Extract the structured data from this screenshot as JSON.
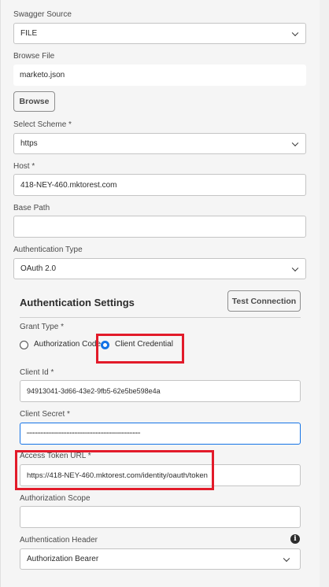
{
  "swagger_source": {
    "label": "Swagger Source",
    "value": "FILE"
  },
  "browse_file": {
    "label": "Browse File",
    "value": "marketo.json",
    "button": "Browse"
  },
  "select_scheme": {
    "label": "Select Scheme *",
    "value": "https"
  },
  "host": {
    "label": "Host *",
    "value": "418-NEY-460.mktorest.com"
  },
  "base_path": {
    "label": "Base Path",
    "value": ""
  },
  "authentication_type": {
    "label": "Authentication Type",
    "value": "OAuth 2.0"
  },
  "auth_settings": {
    "title": "Authentication Settings",
    "test_connection": "Test Connection",
    "grant_type": {
      "label": "Grant Type *",
      "options": [
        "Authorization Code",
        "Client Credential"
      ],
      "selected": "Client Credential"
    },
    "client_id": {
      "label": "Client Id *",
      "value": "94913041-3d66-43e2-9fb5-62e5be598e4a"
    },
    "client_secret": {
      "label": "Client Secret *",
      "value": "••••••••••••••••••••••••••••••••••••••••••••••••••••••••••••••••••••••••••"
    },
    "access_token_url": {
      "label": "Access Token URL *",
      "value": "https://418-NEY-460.mktorest.com/identity/oauth/token"
    },
    "authorization_scope": {
      "label": "Authorization Scope",
      "value": ""
    },
    "authentication_header": {
      "label": "Authentication Header",
      "value": "Authorization Bearer",
      "icon": "info-icon"
    }
  },
  "colors": {
    "highlight": "#e21b2a",
    "accent": "#1473e6"
  }
}
